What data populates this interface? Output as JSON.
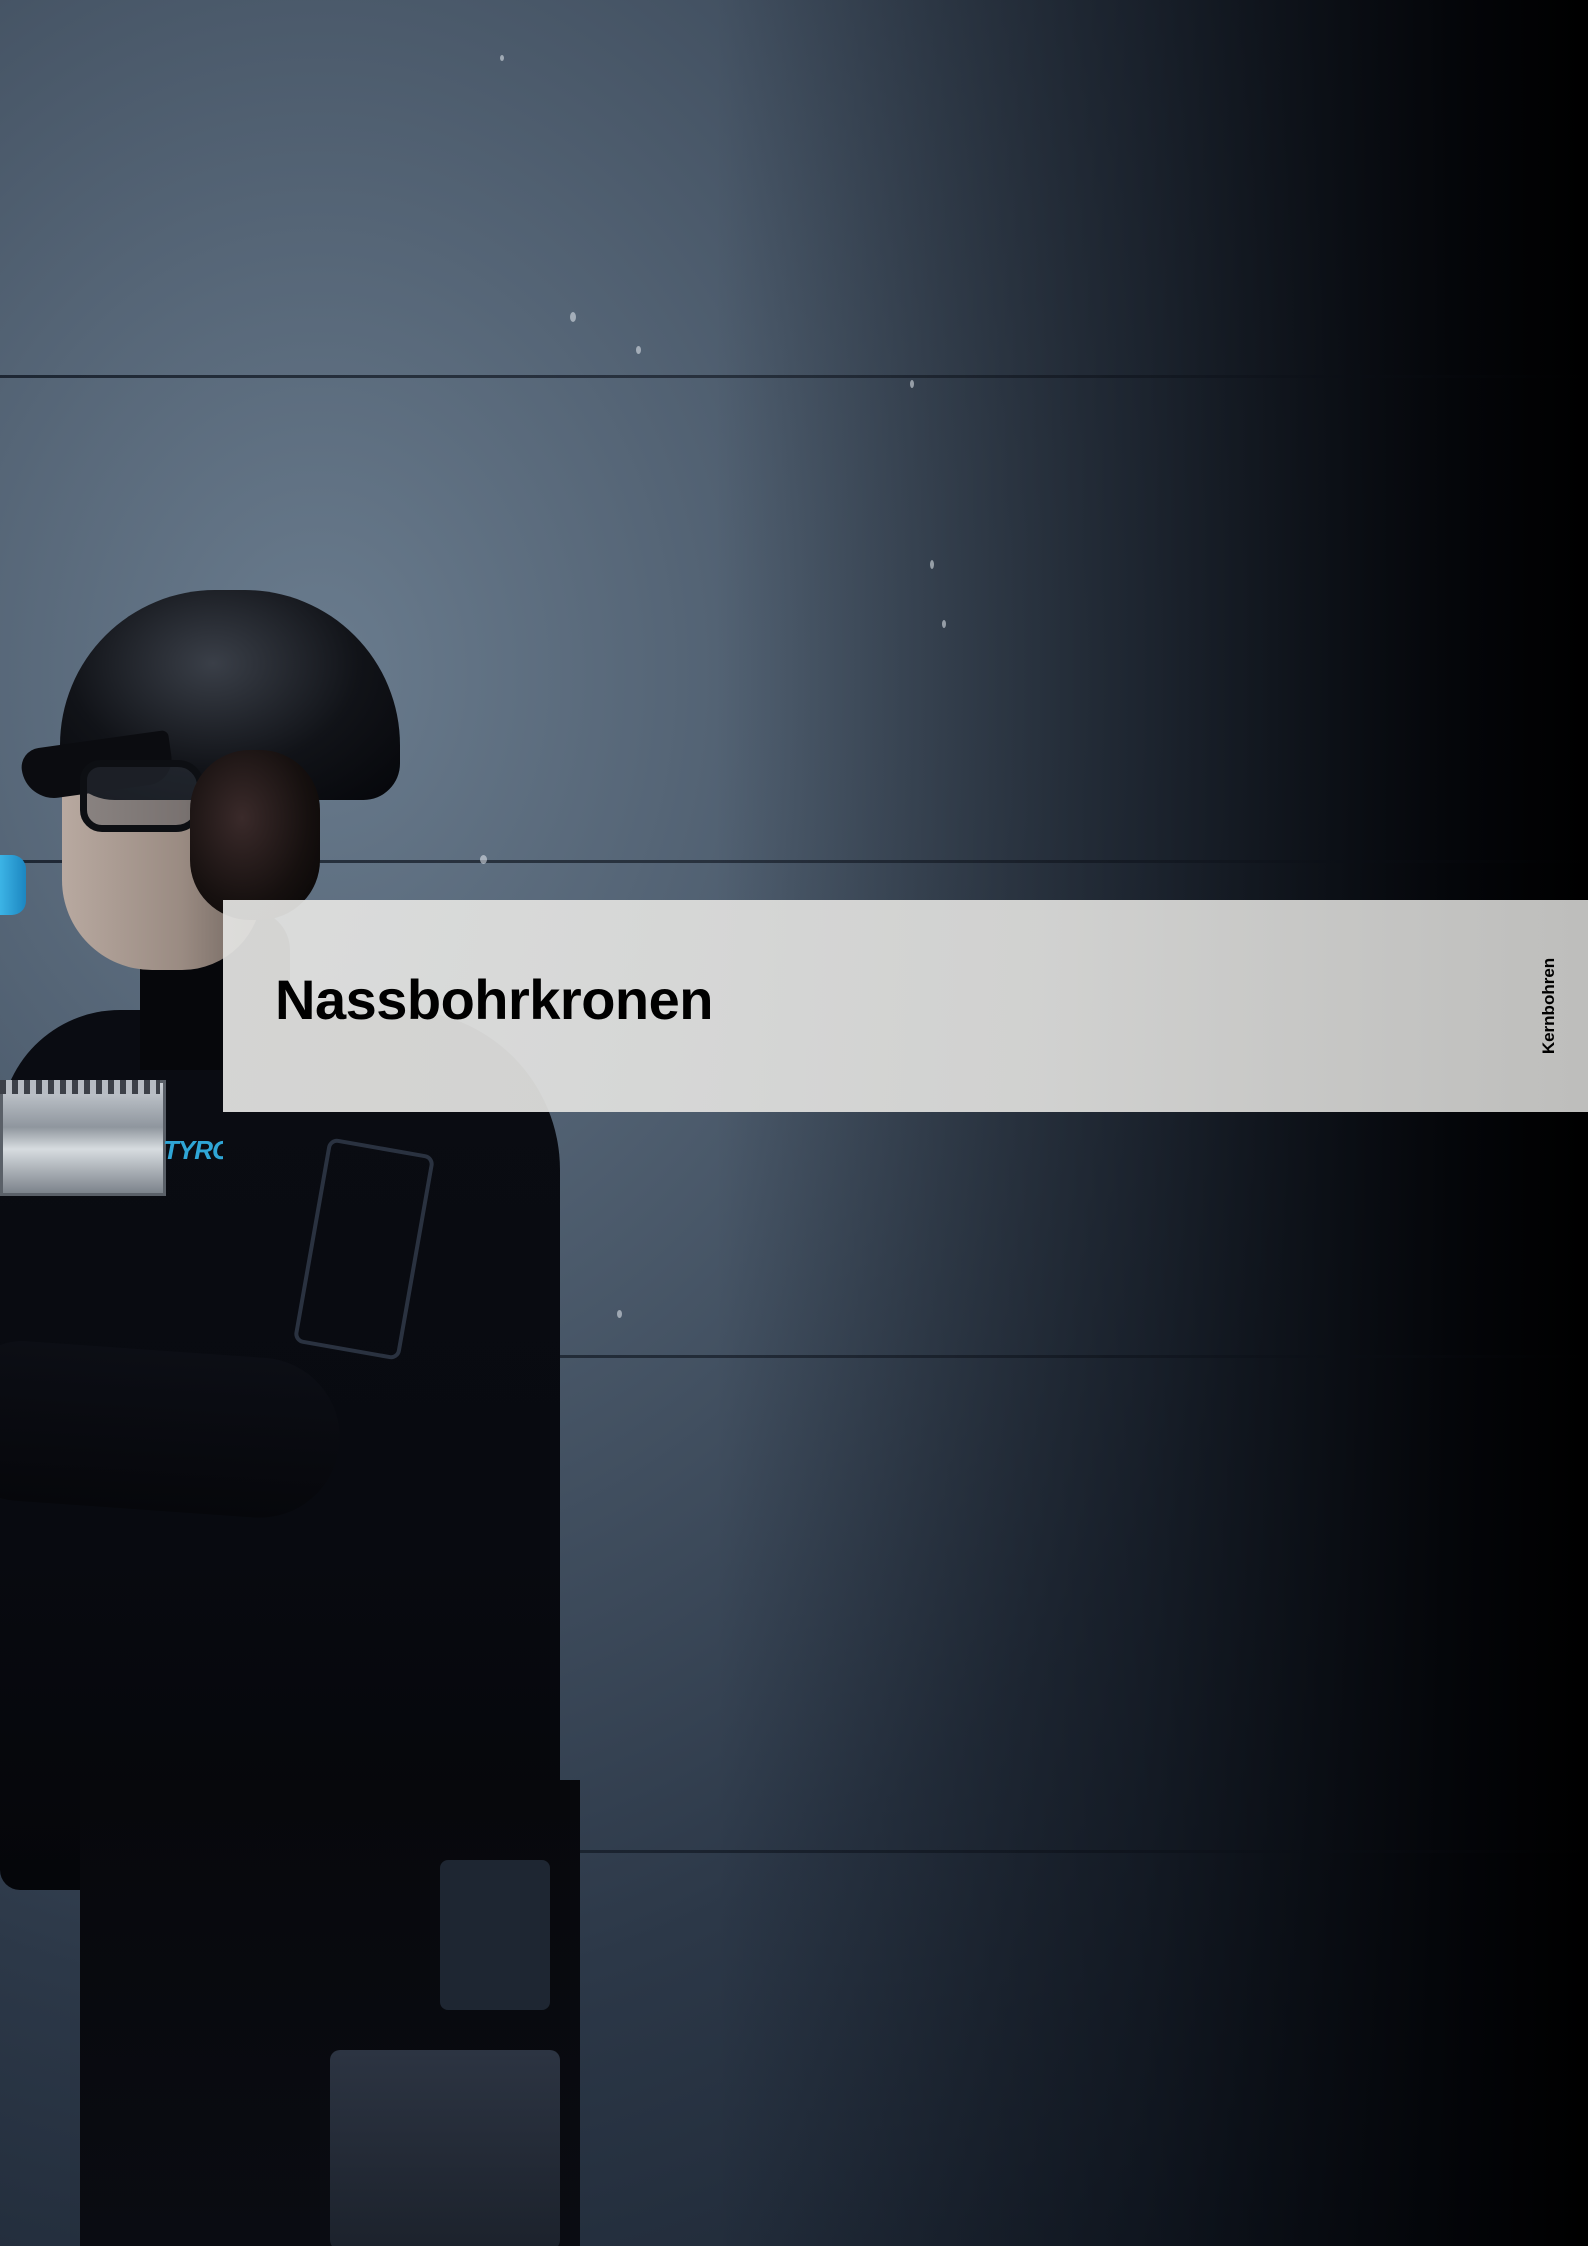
{
  "page": {
    "title": "Nassbohrkronen",
    "section_tab": "Kernbohren"
  },
  "photo": {
    "subject": "worker",
    "logo_text": "TYROL"
  },
  "colors": {
    "band_background": "#dededc",
    "title_text": "#000000",
    "wall_light": "#6a7c8e",
    "wall_dark": "#000000",
    "accent_blue": "#2fa6d6"
  }
}
